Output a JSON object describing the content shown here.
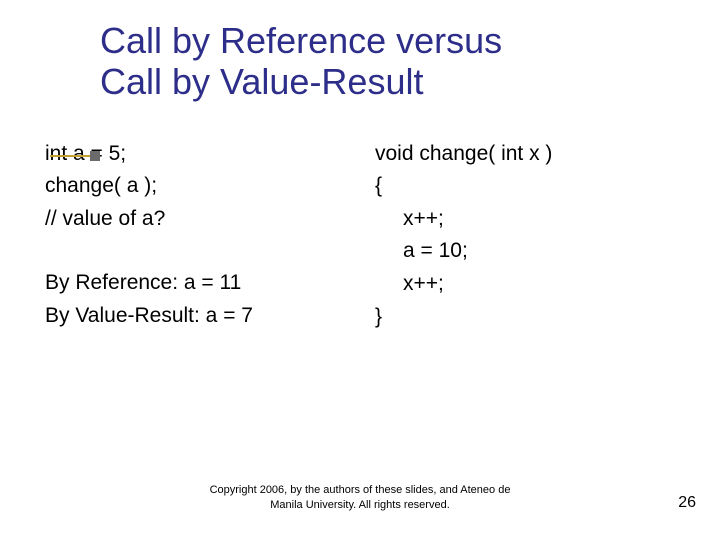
{
  "title_line1": "Call by Reference versus",
  "title_line2": "Call by Value-Result",
  "left": {
    "l1": "int a = 5;",
    "l2": "change( a );",
    "l3": "// value of a?",
    "r1": "By Reference:  a = 11",
    "r2": "By Value-Result:  a = 7"
  },
  "right": {
    "c1": "void change( int x )",
    "c2": "{",
    "c3": "x++;",
    "c4": "a = 10;",
    "c5": "x++;",
    "c6": "}"
  },
  "footer_line1": "Copyright 2006, by the authors of these slides, and Ateneo de",
  "footer_line2": "Manila University. All rights reserved.",
  "page_number": "26"
}
